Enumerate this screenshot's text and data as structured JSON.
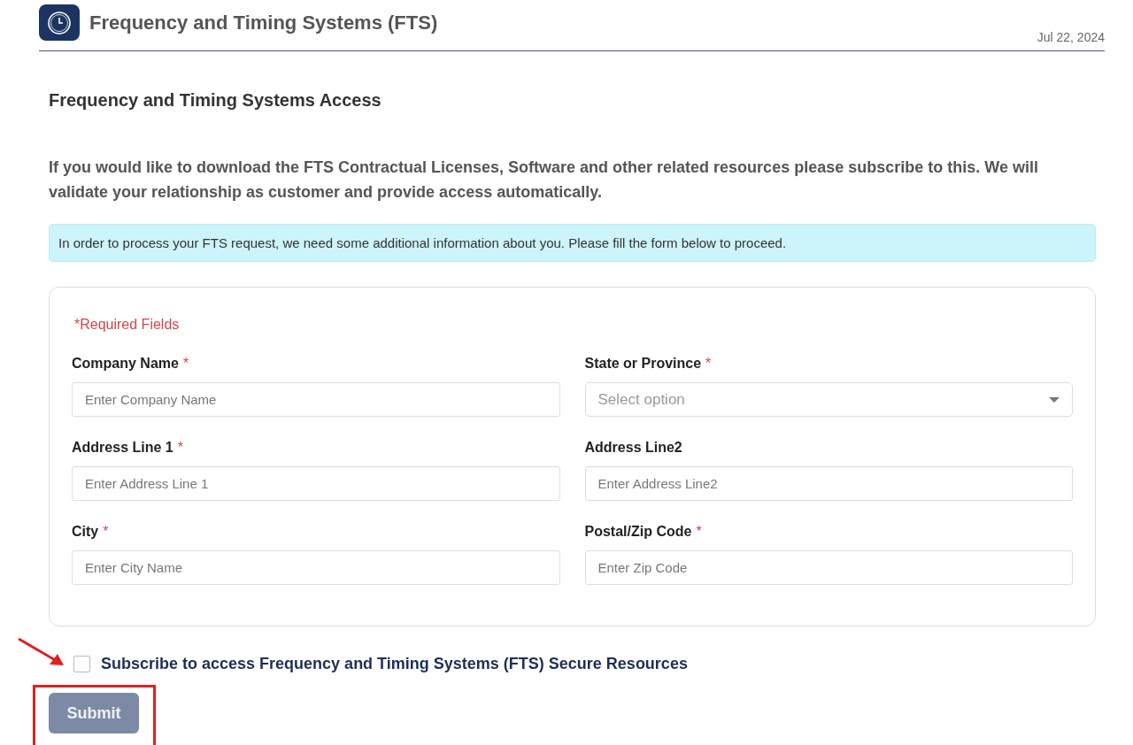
{
  "header": {
    "title": "Frequency and Timing Systems (FTS)",
    "date": "Jul 22, 2024"
  },
  "heading": "Frequency and Timing Systems Access",
  "intro": "If you would like to download the FTS Contractual Licenses, Software and other related resources please subscribe to this. We will validate your relationship as customer and provide access automatically.",
  "notice": "In order to process your FTS request, we need some additional information about you. Please fill the form below to proceed.",
  "form": {
    "required_note": "*Required Fields",
    "fields": [
      {
        "label": "Company Name",
        "required_mark": "*",
        "kind": "text",
        "placeholder": "Enter Company Name"
      },
      {
        "label": "State or Province",
        "required_mark": "*",
        "kind": "select",
        "placeholder": "Select option"
      },
      {
        "label": "Address Line 1",
        "required_mark": "*",
        "kind": "text",
        "placeholder": "Enter Address Line 1"
      },
      {
        "label": "Address Line2",
        "kind": "text",
        "placeholder": "Enter Address Line2"
      },
      {
        "label": "City",
        "required_mark": "*",
        "kind": "text",
        "placeholder": "Enter City Name"
      },
      {
        "label": "Postal/Zip Code",
        "required_mark": "*",
        "kind": "text",
        "placeholder": "Enter Zip Code"
      }
    ]
  },
  "subscribe": {
    "label": "Subscribe to access Frequency and Timing Systems (FTS) Secure Resources",
    "checked": false
  },
  "submit": {
    "label": "Submit",
    "disabled": true
  }
}
